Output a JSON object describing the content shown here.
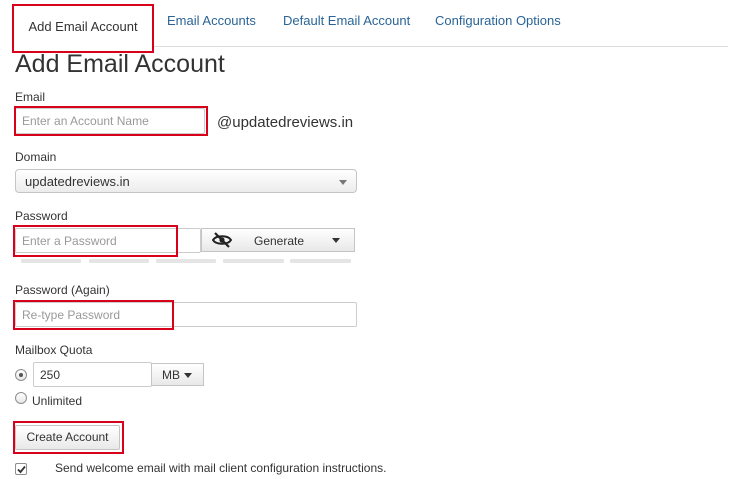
{
  "tabs": [
    {
      "label": "Add Email Account",
      "active": true
    },
    {
      "label": "Email Accounts",
      "active": false
    },
    {
      "label": "Default Email Account",
      "active": false
    },
    {
      "label": "Configuration Options",
      "active": false
    }
  ],
  "page_title": "Add Email Account",
  "email": {
    "label": "Email",
    "placeholder": "Enter an Account Name",
    "suffix": "@updatedreviews.in"
  },
  "domain": {
    "label": "Domain",
    "selected": "updatedreviews.in"
  },
  "password": {
    "label": "Password",
    "placeholder": "Enter a Password",
    "generate_label": "Generate",
    "visibility_icon": "eye-slash-icon"
  },
  "password_again": {
    "label": "Password (Again)",
    "placeholder": "Re-type Password"
  },
  "quota": {
    "label": "Mailbox Quota",
    "value": "250",
    "unit": "MB",
    "unlimited_label": "Unlimited",
    "selected_option": "value"
  },
  "create_button": "Create Account",
  "welcome_email": {
    "label": "Send welcome email with mail client configuration instructions.",
    "checked": true
  },
  "colors": {
    "highlight": "#d9001b",
    "link": "#2a6496"
  }
}
